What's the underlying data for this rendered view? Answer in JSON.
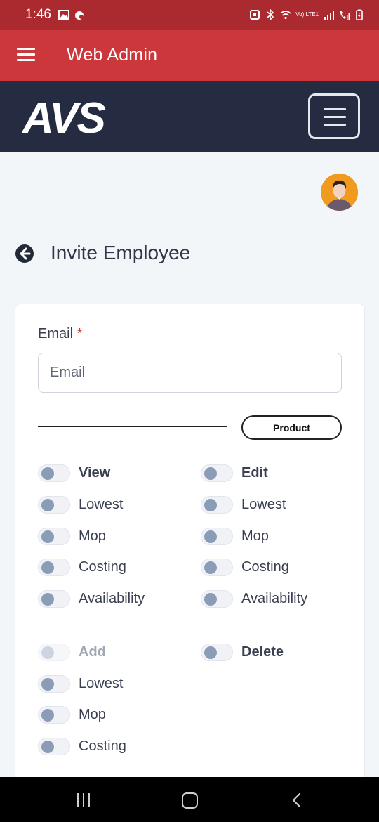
{
  "status_bar": {
    "time": "1:46",
    "left_icons": [
      "image-icon",
      "alarm-icon"
    ],
    "right_icons": [
      "nfc-icon",
      "bluetooth-icon",
      "wifi-icon",
      "volte-lte-signal-icon",
      "call-signal-icon",
      "battery-icon"
    ],
    "network_label": "Vo) LTE1"
  },
  "app_bar": {
    "title": "Web Admin"
  },
  "brand": {
    "logo_text": "AVS"
  },
  "page": {
    "title": "Invite Employee"
  },
  "form": {
    "email_label": "Email",
    "required_mark": "*",
    "email_placeholder": "Email",
    "email_value": "",
    "product_button": "Product"
  },
  "permissions": {
    "view": {
      "header": "View",
      "items": [
        "Lowest",
        "Mop",
        "Costing",
        "Availability"
      ]
    },
    "edit": {
      "header": "Edit",
      "items": [
        "Lowest",
        "Mop",
        "Costing",
        "Availability"
      ]
    },
    "add": {
      "header": "Add",
      "items": [
        "Lowest",
        "Mop",
        "Costing"
      ]
    },
    "delete": {
      "header": "Delete"
    }
  },
  "colors": {
    "status_bar": "#ab2a2f",
    "app_bar": "#cc373c",
    "brand_bar": "#252c42",
    "toggle_knob": "#8b9cb7",
    "required": "#d23a3a"
  }
}
